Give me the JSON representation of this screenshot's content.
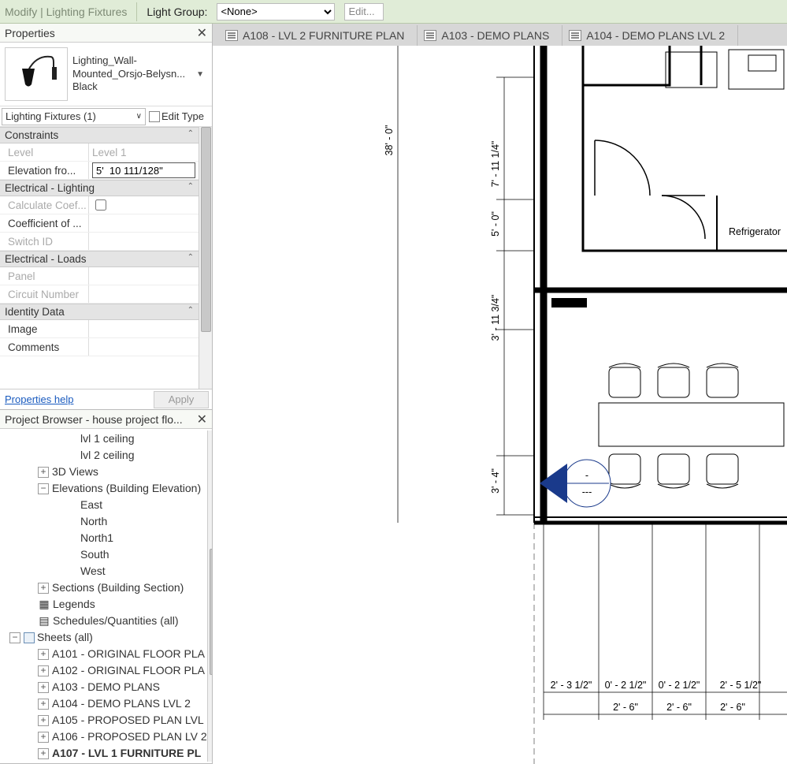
{
  "ribbon": {
    "modify": "Modify | Lighting Fixtures",
    "light_group_label": "Light Group:",
    "light_group_value": "<None>",
    "edit_label": "Edit..."
  },
  "tabs": [
    {
      "label": "A108 - LVL 2 FURNITURE PLAN"
    },
    {
      "label": "A103 - DEMO PLANS"
    },
    {
      "label": "A104 - DEMO PLANS LVL 2"
    }
  ],
  "properties": {
    "title": "Properties",
    "type_name_a": "Lighting_Wall-",
    "type_name_b": "Mounted_Orsjo-Belysn...",
    "type_name_c": "Black",
    "filter": "Lighting Fixtures (1)",
    "edit_type": "Edit Type",
    "groups": {
      "constraints": "Constraints",
      "elec_lighting": "Electrical - Lighting",
      "elec_loads": "Electrical - Loads",
      "identity": "Identity Data"
    },
    "rows": {
      "level_k": "Level",
      "level_v": "Level 1",
      "elev_k": "Elevation fro...",
      "elev_v": "5'  10 111/128\"",
      "calc_coef_k": "Calculate Coef...",
      "coef_util_k": "Coefficient of ...",
      "switch_id_k": "Switch ID",
      "panel_k": "Panel",
      "circuit_k": "Circuit Number",
      "image_k": "Image",
      "comments_k": "Comments"
    },
    "help_link": "Properties help",
    "apply_label": "Apply"
  },
  "browser": {
    "title": "Project Browser - house project flo...",
    "items": [
      {
        "indent": 4,
        "exp": null,
        "icon": null,
        "label": "lvl 1 ceiling",
        "bold": false
      },
      {
        "indent": 4,
        "exp": null,
        "icon": null,
        "label": "lvl 2 ceiling",
        "bold": false
      },
      {
        "indent": 2,
        "exp": "+",
        "icon": null,
        "label": "3D Views",
        "bold": false
      },
      {
        "indent": 2,
        "exp": "−",
        "icon": null,
        "label": "Elevations (Building Elevation)",
        "bold": false
      },
      {
        "indent": 4,
        "exp": null,
        "icon": null,
        "label": "East",
        "bold": false
      },
      {
        "indent": 4,
        "exp": null,
        "icon": null,
        "label": "North",
        "bold": false
      },
      {
        "indent": 4,
        "exp": null,
        "icon": null,
        "label": "North1",
        "bold": false
      },
      {
        "indent": 4,
        "exp": null,
        "icon": null,
        "label": "South",
        "bold": false
      },
      {
        "indent": 4,
        "exp": null,
        "icon": null,
        "label": "West",
        "bold": false
      },
      {
        "indent": 2,
        "exp": "+",
        "icon": null,
        "label": "Sections (Building Section)",
        "bold": false
      },
      {
        "indent": 1,
        "exp": null,
        "icon": "legend",
        "label": "Legends",
        "bold": false
      },
      {
        "indent": 1,
        "exp": null,
        "icon": "sched",
        "label": "Schedules/Quantities (all)",
        "bold": false
      },
      {
        "indent": 0,
        "exp": "−",
        "icon": "sheet",
        "label": "Sheets (all)",
        "bold": false
      },
      {
        "indent": 2,
        "exp": "+",
        "icon": null,
        "label": "A101 - ORIGINAL FLOOR PLA",
        "bold": false
      },
      {
        "indent": 2,
        "exp": "+",
        "icon": null,
        "label": "A102 - ORIGINAL FLOOR PLA",
        "bold": false
      },
      {
        "indent": 2,
        "exp": "+",
        "icon": null,
        "label": "A103 - DEMO PLANS",
        "bold": false
      },
      {
        "indent": 2,
        "exp": "+",
        "icon": null,
        "label": "A104 - DEMO PLANS LVL 2",
        "bold": false
      },
      {
        "indent": 2,
        "exp": "+",
        "icon": null,
        "label": "A105 - PROPOSED PLAN LVL",
        "bold": false
      },
      {
        "indent": 2,
        "exp": "+",
        "icon": null,
        "label": "A106 - PROPOSED PLAN LV 2",
        "bold": false
      },
      {
        "indent": 2,
        "exp": "+",
        "icon": null,
        "label": "A107 - LVL 1 FURNITURE PL",
        "bold": true
      }
    ]
  },
  "drawing": {
    "dims": {
      "overall_h": "38' - 0\"",
      "d1": "7' - 11 1/4\"",
      "d2": "5' - 0\"",
      "d3": "3' - 11 3/4\"",
      "d4": "3' - 4\"",
      "b1": "2' - 3 1/2\"",
      "b2": "0' - 2 1/2\"",
      "b2b": "2' - 6\"",
      "b3": "0' - 2 1/2\"",
      "b3b": "2' - 6\"",
      "b4": "2' - 5 1/2\"",
      "b4b": "2' - 6\""
    },
    "room_label": "Refrigerator",
    "fixture_tag_a": "-",
    "fixture_tag_b": "---"
  }
}
